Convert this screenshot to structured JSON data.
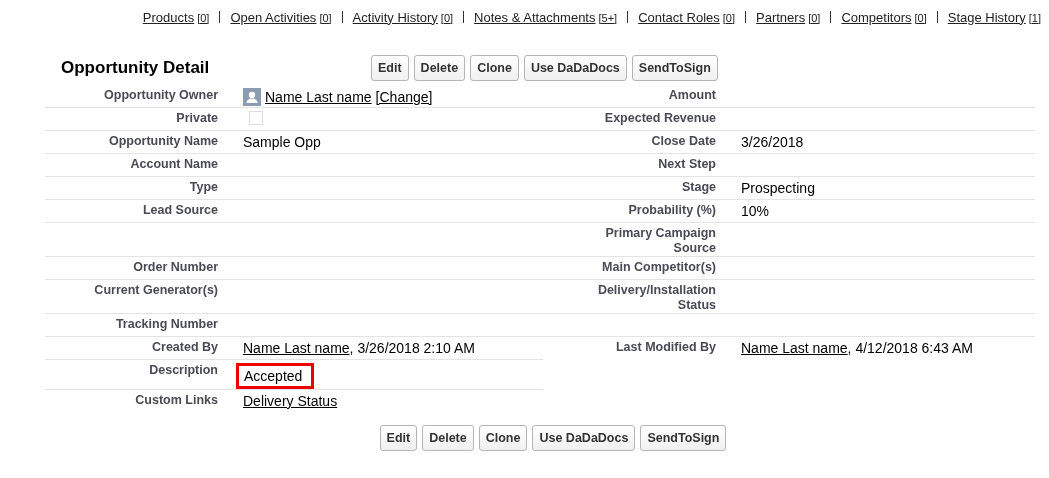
{
  "related_links": [
    {
      "label": "Products",
      "count": "[0]"
    },
    {
      "label": "Open Activities",
      "count": "[0]"
    },
    {
      "label": "Activity History",
      "count": "[0]"
    },
    {
      "label": "Notes & Attachments",
      "count": "[5+]"
    },
    {
      "label": "Contact Roles",
      "count": "[0]"
    },
    {
      "label": "Partners",
      "count": "[0]"
    },
    {
      "label": "Competitors",
      "count": "[0]"
    },
    {
      "label": "Stage History",
      "count": "[1]"
    }
  ],
  "detail": {
    "title": "Opportunity Detail",
    "top_buttons": [
      "Edit",
      "Delete",
      "Clone",
      "Use DaDaDocs",
      "SendToSign"
    ],
    "rows": [
      {
        "left_label": "Opportunity Owner",
        "left_value": {
          "kind": "owner",
          "link": "Name Last name",
          "action": "[Change]"
        },
        "right_label": "Amount"
      },
      {
        "left_label": "Private",
        "left_value": {
          "kind": "checkbox",
          "checked": false
        },
        "right_label": "Expected Revenue"
      },
      {
        "left_label": "Opportunity Name",
        "left_value": {
          "kind": "text",
          "text": "Sample Opp"
        },
        "right_label": "Close Date",
        "right_value": {
          "kind": "text",
          "text": "3/26/2018"
        }
      },
      {
        "left_label": "Account Name",
        "right_label": "Next Step"
      },
      {
        "left_label": "Type",
        "right_label": "Stage",
        "right_value": {
          "kind": "text",
          "text": "Prospecting"
        }
      },
      {
        "left_label": "Lead Source",
        "right_label": "Probability (%)",
        "right_value": {
          "kind": "text",
          "text": "10%"
        }
      },
      {
        "right_label": "Primary Campaign Source"
      },
      {
        "left_label": "Order Number",
        "right_label": "Main Competitor(s)"
      },
      {
        "left_label": "Current Generator(s)",
        "right_label": "Delivery/Installation Status"
      },
      {
        "left_label": "Tracking Number"
      },
      {
        "left_label": "Created By",
        "left_value": {
          "kind": "link",
          "link": "Name Last name",
          "suffix": ", 3/26/2018 2:10 AM"
        },
        "right_label": "Last Modified By",
        "right_value": {
          "kind": "link",
          "link": "Name Last name",
          "suffix": ", 4/12/2018 6:43 AM"
        }
      },
      {
        "left_label": "Description",
        "left_value": {
          "kind": "text",
          "text": "Accepted",
          "highlighted": true
        }
      },
      {
        "left_label": "Custom Links",
        "left_value": {
          "kind": "link",
          "link": "Delivery Status"
        }
      }
    ],
    "bottom_buttons": [
      "Edit",
      "Delete",
      "Clone",
      "Use DaDaDocs",
      "SendToSign"
    ]
  }
}
